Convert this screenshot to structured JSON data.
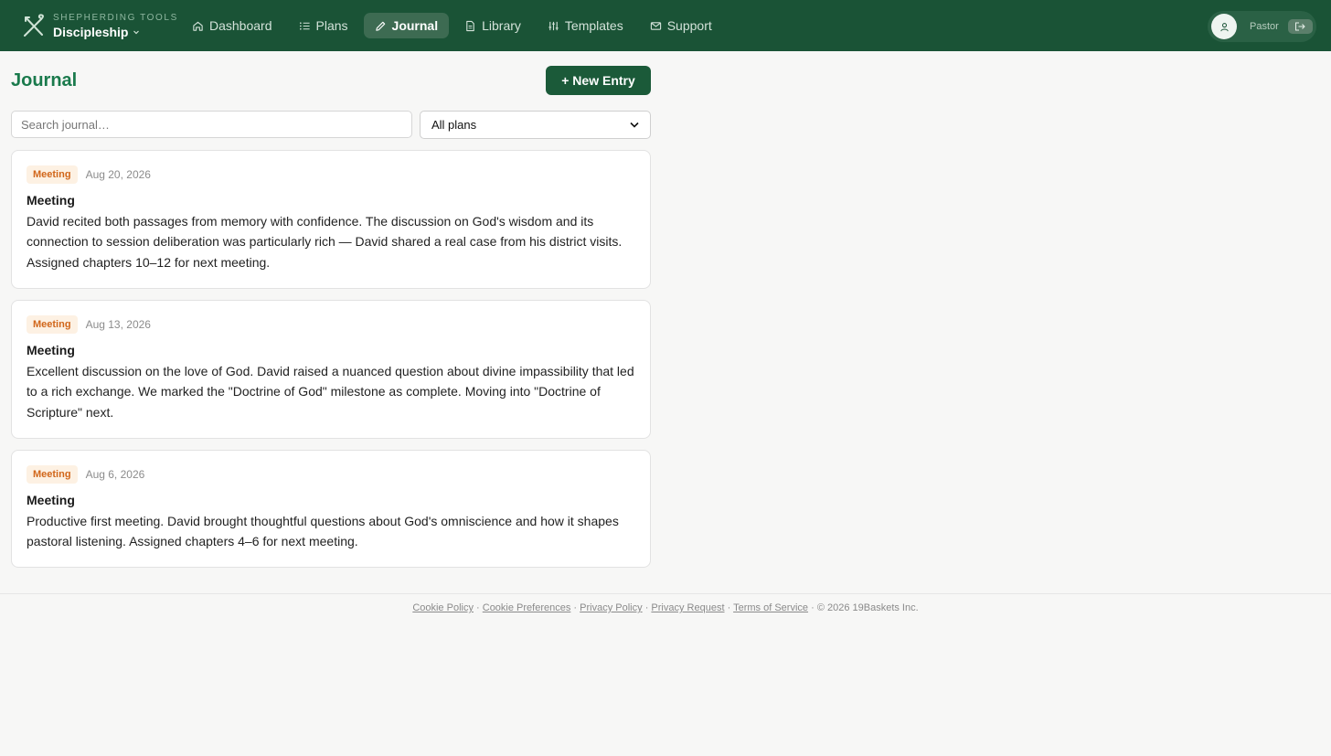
{
  "brand": {
    "kicker": "SHEPHERDING TOOLS",
    "name": "Discipleship"
  },
  "nav": {
    "items": [
      {
        "label": "Dashboard",
        "icon": "home-icon",
        "active": false
      },
      {
        "label": "Plans",
        "icon": "list-icon",
        "active": false
      },
      {
        "label": "Journal",
        "icon": "pencil-icon",
        "active": true
      },
      {
        "label": "Library",
        "icon": "document-icon",
        "active": false
      },
      {
        "label": "Templates",
        "icon": "sliders-icon",
        "active": false
      },
      {
        "label": "Support",
        "icon": "mail-icon",
        "active": false
      }
    ]
  },
  "user": {
    "role": "Pastor",
    "avatar_icon": "user-icon",
    "logout_icon": "logout-icon"
  },
  "main": {
    "title": "Journal",
    "new_entry_label": "+ New Entry",
    "search_placeholder": "Search journal…",
    "plan_filter": {
      "selected": "All plans"
    }
  },
  "entries": [
    {
      "badge": "Meeting",
      "date": "Aug 20, 2026",
      "title": "Meeting",
      "body": "David recited both passages from memory with confidence. The discussion on God's wisdom and its connection to session deliberation was particularly rich — David shared a real case from his district visits. Assigned chapters 10–12 for next meeting."
    },
    {
      "badge": "Meeting",
      "date": "Aug 13, 2026",
      "title": "Meeting",
      "body": "Excellent discussion on the love of God. David raised a nuanced question about divine impassibility that led to a rich exchange. We marked the \"Doctrine of God\" milestone as complete. Moving into \"Doctrine of Scripture\" next."
    },
    {
      "badge": "Meeting",
      "date": "Aug 6, 2026",
      "title": "Meeting",
      "body": "Productive first meeting. David brought thoughtful questions about God's omniscience and how it shapes pastoral listening. Assigned chapters 4–6 for next meeting."
    }
  ],
  "footer": {
    "links": [
      "Cookie Policy",
      "Cookie Preferences",
      "Privacy Policy",
      "Privacy Request",
      "Terms of Service"
    ],
    "separator": "·",
    "copyright": "© 2026 19Baskets Inc."
  },
  "colors": {
    "nav_bg": "#1a5336",
    "accent": "#1a7a4c",
    "button_bg": "#1b5a39",
    "badge_bg": "#fdf1e3",
    "badge_text": "#d1661a",
    "page_bg": "#f7f7f6"
  }
}
